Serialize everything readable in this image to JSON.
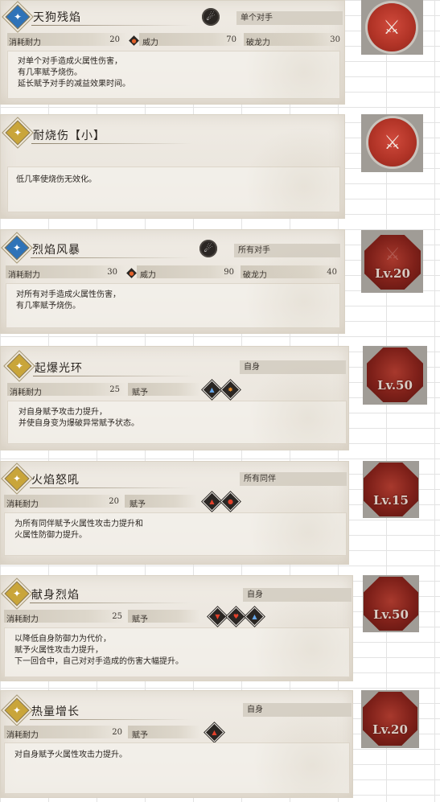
{
  "labels": {
    "cost": "消耗耐力",
    "power": "威力",
    "dragon": "破龙力",
    "grant": "赋予"
  },
  "skills": [
    {
      "name": "天狗残焰",
      "target": "单个对手",
      "cost": "20",
      "power": "70",
      "dragon": "30",
      "description": "对单个对手造成火属性伤害，\n有几率赋予烧伤。\n延长赋予对手的减益效果时间。",
      "unlock": "",
      "icon_color": "#2f73b8"
    },
    {
      "name": "耐烧伤【小】",
      "description": "低几率使烧伤无效化。",
      "unlock": ""
    },
    {
      "name": "烈焰风暴",
      "target": "所有对手",
      "cost": "30",
      "power": "90",
      "dragon": "40",
      "description": "对所有对手造成火属性伤害，\n有几率赋予烧伤。",
      "unlock": "Lv.20"
    },
    {
      "name": "起爆光环",
      "target": "自身",
      "cost": "25",
      "description": "对自身赋予攻击力提升，\n并使自身变为爆破异常赋予状态。",
      "unlock": "Lv.50"
    },
    {
      "name": "火焰怒吼",
      "target": "所有同伴",
      "cost": "20",
      "description": "为所有同伴赋予火属性攻击力提升和\n火属性防御力提升。",
      "unlock": "Lv.15"
    },
    {
      "name": "献身烈焰",
      "target": "自身",
      "cost": "25",
      "description": "以降低自身防御力为代价，\n赋予火属性攻击力提升，\n下一回合中，自己对对手造成的伤害大幅提升。",
      "unlock": "Lv.50"
    },
    {
      "name": "热量增长",
      "target": "自身",
      "cost": "20",
      "description": "对自身赋予火属性攻击力提升。",
      "unlock": "Lv.20"
    }
  ],
  "icons": {
    "skill_blue": "#2f73b8",
    "skill_gold": "#c9a53a",
    "badge_red": "#a8392d"
  }
}
